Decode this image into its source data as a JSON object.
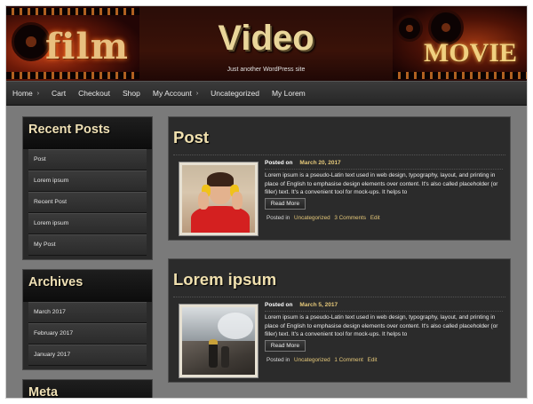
{
  "header": {
    "logo_left": "film",
    "site_title": "Video",
    "tagline": "Just another WordPress site",
    "logo_right": "MOVIE"
  },
  "nav": {
    "items": [
      {
        "label": "Home",
        "has_arrow": true
      },
      {
        "label": "Cart",
        "has_arrow": false
      },
      {
        "label": "Checkout",
        "has_arrow": false
      },
      {
        "label": "Shop",
        "has_arrow": false
      },
      {
        "label": "My Account",
        "has_arrow": true
      },
      {
        "label": "Uncategorized",
        "has_arrow": false
      },
      {
        "label": "My Lorem",
        "has_arrow": false
      }
    ]
  },
  "sidebar": {
    "recent_posts": {
      "title": "Recent Posts",
      "items": [
        "Post",
        "Lorem ipsum",
        "Recent Post",
        "Lorem ipsum",
        "My Post"
      ]
    },
    "archives": {
      "title": "Archives",
      "items": [
        "March 2017",
        "February 2017",
        "January 2017"
      ]
    },
    "meta": {
      "title": "Meta"
    }
  },
  "posts": [
    {
      "title": "Post",
      "posted_on_label": "Posted on",
      "date": "March 20, 2017",
      "excerpt": "Lorem ipsum is a pseudo-Latin text used in web design, typography, layout, and printing in place of English to emphasise design elements over content. It's also called placeholder (or filler) text. It's a convenient tool for mock-ups. It helps to",
      "read_more": "Read More",
      "posted_in_label": "Posted in",
      "category": "Uncategorized",
      "comments": "3 Comments",
      "edit": "Edit"
    },
    {
      "title": "Lorem ipsum",
      "posted_on_label": "Posted on",
      "date": "March 5, 2017",
      "excerpt": "Lorem ipsum is a pseudo-Latin text used in web design, typography, layout, and printing in place of English to emphasise design elements over content. It's also called placeholder (or filler) text. It's a convenient tool for mock-ups. It helps to",
      "read_more": "Read More",
      "posted_in_label": "Posted in",
      "category": "Uncategorized",
      "comments": "1 Comment",
      "edit": "Edit"
    }
  ],
  "colors": {
    "accent_gold": "#e6c97a",
    "title_cream": "#f0e0ae",
    "page_gray": "#7a7a7a"
  }
}
